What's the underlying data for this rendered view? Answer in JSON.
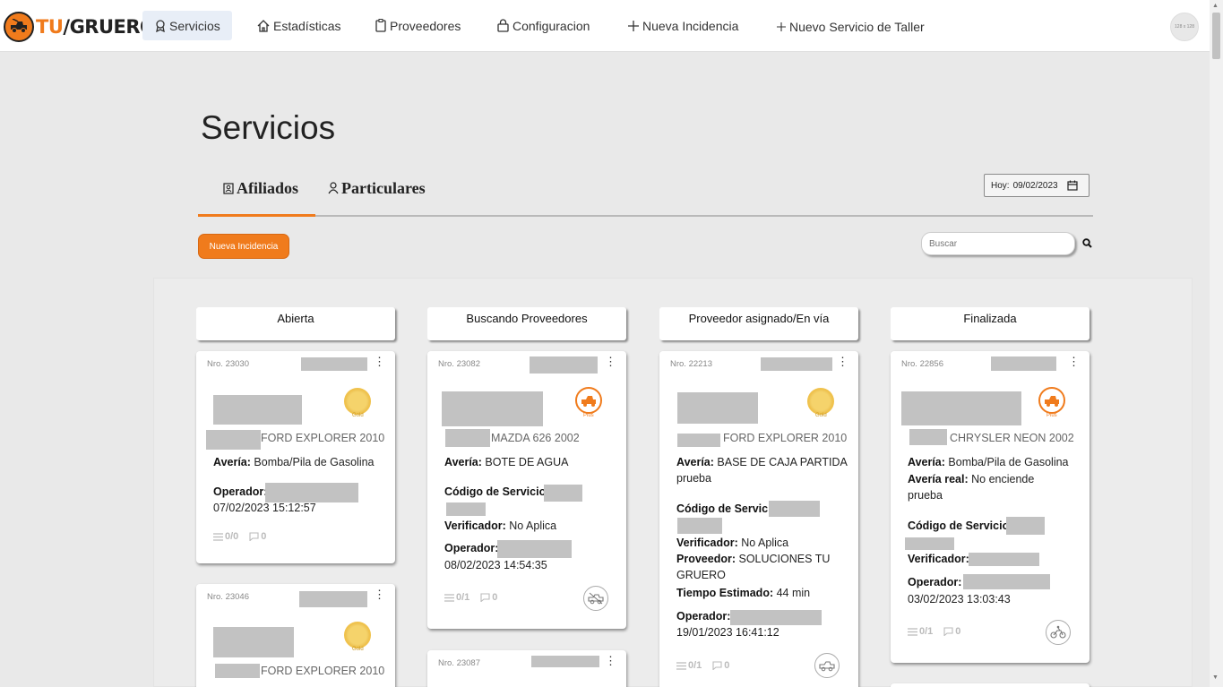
{
  "app": {
    "logo_tu": "TU",
    "logo_rest": "GRUERO"
  },
  "nav": {
    "servicios": "Servicios",
    "estadisticas": "Estadísticas",
    "proveedores": "Proveedores",
    "configuracion": "Configuracion",
    "nueva_incidencia": "Nueva Incidencia",
    "nuevo_servicio": "Nuevo Servicio de Taller",
    "avatar_text": "128 x 128"
  },
  "page": {
    "title": "Servicios"
  },
  "tabs": {
    "afiliados": "Afiliados",
    "particulares": "Particulares"
  },
  "date": {
    "label": "Hoy:",
    "value": "09/02/2023"
  },
  "toolbar": {
    "new_incidence": "Nueva Incidencia",
    "search_placeholder": "Buscar"
  },
  "columns": [
    "Abierta",
    "Buscando Proveedores",
    "Proveedor asignado/En vía",
    "Finalizada"
  ],
  "cards": {
    "c1": {
      "nro": "Nro. 23030",
      "badge": "Gold",
      "car": "FORD EXPLORER 2010",
      "averia_lbl": "Avería:",
      "averia": "Bomba/Pila de Gasolina",
      "operador_lbl": "Operador:",
      "fecha": "07/02/2023 15:12:57",
      "notes": "0/0",
      "comments": "0"
    },
    "c2": {
      "nro": "Nro. 23046",
      "badge": "Gold",
      "car": "FORD EXPLORER 2010"
    },
    "c3": {
      "nro": "Nro. 23082",
      "badge": "Plus",
      "car": "MAZDA 626 2002",
      "averia_lbl": "Avería:",
      "averia": "BOTE DE AGUA",
      "codigo_lbl": "Código de Servicio:",
      "verificador_lbl": "Verificador:",
      "verificador": "No Aplica",
      "operador_lbl": "Operador:",
      "fecha": "08/02/2023 14:54:35",
      "notes": "0/1",
      "comments": "0"
    },
    "c4": {
      "nro": "Nro. 23087"
    },
    "c5": {
      "nro": "Nro. 22213",
      "badge": "Gold",
      "car": "FORD EXPLORER 2010",
      "averia_lbl": "Avería:",
      "averia": "BASE DE CAJA PARTIDA",
      "averia_note": "prueba",
      "codigo_lbl": "Código de Servicio",
      "verificador_lbl": "Verificador:",
      "verificador": "No Aplica",
      "proveedor_lbl": "Proveedor:",
      "proveedor": "SOLUCIONES TU GRUERO",
      "tiempo_lbl": "Tiempo Estimado:",
      "tiempo": "44 min",
      "operador_lbl": "Operador:",
      "fecha": "19/01/2023 16:41:12",
      "notes": "0/1",
      "comments": "0"
    },
    "c6": {
      "nro": "Nro. 22856",
      "badge": "Plus",
      "car": "CHRYSLER NEON 2002",
      "averia_lbl": "Avería:",
      "averia": "Bomba/Pila de Gasolina",
      "averia_real_lbl": "Avería real:",
      "averia_real": "No enciende prueba",
      "codigo_lbl": "Código de Servicio:",
      "verificador_lbl": "Verificador:",
      "operador_lbl": "Operador:",
      "fecha": "03/02/2023 13:03:43",
      "notes": "0/1",
      "comments": "0"
    }
  },
  "colors": {
    "brand": "#f07b1c",
    "nav_active_bg": "#e8eef7",
    "redacted": "#c2c2c2"
  }
}
